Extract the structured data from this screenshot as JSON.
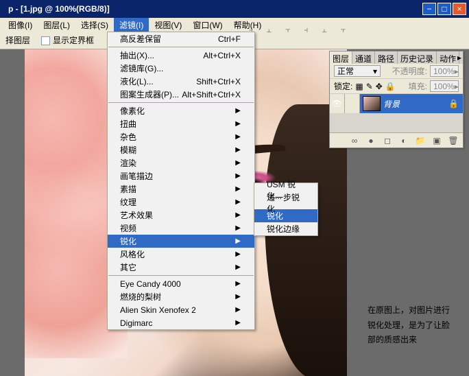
{
  "title": "p - [1.jpg @ 100%(RGB/8)]",
  "menubar": [
    "图像(I)",
    "图层(L)",
    "选择(S)",
    "滤镜(I)",
    "视图(V)",
    "窗口(W)",
    "帮助(H)"
  ],
  "menubar_active_index": 3,
  "toolbar": {
    "row_label": "择图层",
    "checkbox_label": "显示定界框"
  },
  "dropdown": {
    "sections": [
      [
        {
          "label": "高反差保留",
          "shortcut": "Ctrl+F",
          "arrow": false
        }
      ],
      [
        {
          "label": "抽出(X)...",
          "shortcut": "Alt+Ctrl+X",
          "arrow": false
        },
        {
          "label": "滤镜库(G)...",
          "shortcut": "",
          "arrow": false
        },
        {
          "label": "液化(L)...",
          "shortcut": "Shift+Ctrl+X",
          "arrow": false
        },
        {
          "label": "图案生成器(P)...",
          "shortcut": "Alt+Shift+Ctrl+X",
          "arrow": false
        }
      ],
      [
        {
          "label": "像素化",
          "shortcut": "",
          "arrow": true
        },
        {
          "label": "扭曲",
          "shortcut": "",
          "arrow": true
        },
        {
          "label": "杂色",
          "shortcut": "",
          "arrow": true
        },
        {
          "label": "模糊",
          "shortcut": "",
          "arrow": true
        },
        {
          "label": "渲染",
          "shortcut": "",
          "arrow": true
        },
        {
          "label": "画笔描边",
          "shortcut": "",
          "arrow": true
        },
        {
          "label": "素描",
          "shortcut": "",
          "arrow": true
        },
        {
          "label": "纹理",
          "shortcut": "",
          "arrow": true
        },
        {
          "label": "艺术效果",
          "shortcut": "",
          "arrow": true
        },
        {
          "label": "视频",
          "shortcut": "",
          "arrow": true
        },
        {
          "label": "锐化",
          "shortcut": "",
          "arrow": true,
          "hl": true
        },
        {
          "label": "风格化",
          "shortcut": "",
          "arrow": true
        },
        {
          "label": "其它",
          "shortcut": "",
          "arrow": true
        }
      ],
      [
        {
          "label": "Eye Candy 4000",
          "shortcut": "",
          "arrow": true
        },
        {
          "label": "燃烧的梨树",
          "shortcut": "",
          "arrow": true
        },
        {
          "label": "Alien Skin Xenofex 2",
          "shortcut": "",
          "arrow": true
        },
        {
          "label": "Digimarc",
          "shortcut": "",
          "arrow": true
        }
      ]
    ]
  },
  "submenu": [
    {
      "label": "USM 锐化...",
      "hl": false
    },
    {
      "label": "进一步锐化",
      "hl": false
    },
    {
      "label": "锐化",
      "hl": true
    },
    {
      "label": "锐化边缘",
      "hl": false
    }
  ],
  "panel": {
    "tabs": [
      "图层",
      "通道",
      "路径",
      "历史记录",
      "动作"
    ],
    "active_tab": 0,
    "blend_mode": "正常",
    "opacity_label": "不透明度:",
    "opacity_value": "100%",
    "lock_label": "锁定:",
    "fill_label": "填充:",
    "fill_value": "100%",
    "layer_name": "背景"
  },
  "caption": "在原图上，对图片进行锐化处理，是为了让脸部的质感出来",
  "icons": {
    "eye": "👁",
    "lock": "🔒",
    "trash": "🗑",
    "folder": "📁",
    "fx": "●",
    "adj": "◐",
    "new": "▣",
    "link": "∞"
  }
}
